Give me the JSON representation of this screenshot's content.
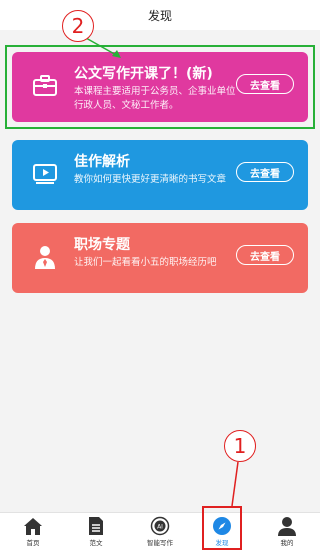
{
  "header": {
    "title": "发现"
  },
  "cards": [
    {
      "icon": "briefcase-icon",
      "title": "公文写作开课了！(新)",
      "desc": "本课程主要适用于公务员、企事业单位行政人员、文秘工作者。",
      "button": "去查看",
      "color": "#e0399f"
    },
    {
      "icon": "video-play-icon",
      "title": "佳作解析",
      "desc": "教你如何更快更好更清晰的书写文章",
      "button": "去查看",
      "color": "#1f98e0"
    },
    {
      "icon": "user-tie-icon",
      "title": "职场专题",
      "desc": "让我们一起看看小五的职场经历吧",
      "button": "去查看",
      "color": "#f26a63"
    }
  ],
  "annotations": {
    "callout_1": "1",
    "callout_2": "2"
  },
  "tabs": [
    {
      "label": "首页",
      "icon": "home-icon"
    },
    {
      "label": "范文",
      "icon": "document-icon"
    },
    {
      "label": "智能写作",
      "icon": "ai-icon"
    },
    {
      "label": "发现",
      "icon": "compass-icon",
      "active": true
    },
    {
      "label": "我的",
      "icon": "person-icon"
    }
  ],
  "colors": {
    "accent": "#1e88e5",
    "highlight_green": "#27b037",
    "highlight_red": "#e02020"
  }
}
